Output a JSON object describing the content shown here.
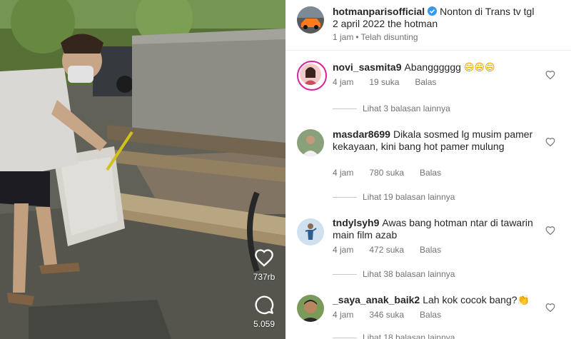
{
  "post": {
    "username": "hotmanparisofficial",
    "caption": "Nonton di Trans tv tgl 2 april 2022 the hotman",
    "time": "1 jam",
    "separator": "•",
    "edited": "Telah disunting"
  },
  "video": {
    "likes_count": "737rb",
    "comments_count": "5.059"
  },
  "comments": [
    {
      "username": "novi_sasmita9",
      "text": "Abangggggg",
      "emoji": "😄😄😄",
      "time": "4 jam",
      "likes": "19 suka",
      "reply": "Balas",
      "view_replies": "Lihat 3 balasan lainnya"
    },
    {
      "username": "masdar8699",
      "text": "Dikala sosmed lg musim pamer kekayaan,  kini bang hot pamer mulung",
      "emoji": "",
      "time": "4 jam",
      "likes": "780 suka",
      "reply": "Balas",
      "view_replies": "Lihat 19 balasan lainnya"
    },
    {
      "username": "tndylsyh9",
      "text": "Awas bang hotman ntar di tawarin main film azab",
      "emoji": "",
      "time": "4 jam",
      "likes": "472 suka",
      "reply": "Balas",
      "view_replies": "Lihat 38 balasan lainnya"
    },
    {
      "username": "_saya_anak_baik2",
      "text": "Lah kok cocok bang?",
      "emoji": "👏",
      "time": "4 jam",
      "likes": "346 suka",
      "reply": "Balas",
      "view_replies": "Lihat 18 balasan lainnya"
    }
  ],
  "colors": {
    "verified": "#3897f0",
    "story_ring": "#d6249f",
    "secondary_text": "#737373"
  },
  "icons": {
    "like": "heart-icon",
    "comment": "comment-bubble-icon",
    "verified": "verified-badge-icon",
    "comment_like": "heart-outline-icon"
  }
}
